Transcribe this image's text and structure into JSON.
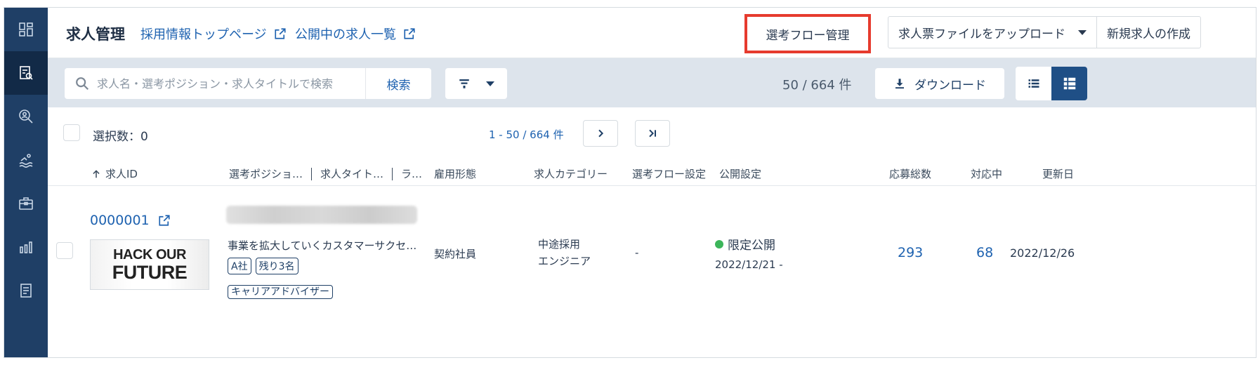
{
  "sidebar": {
    "items": [
      {
        "icon": "dashboard-icon"
      },
      {
        "icon": "job-list-icon"
      },
      {
        "icon": "candidate-search-icon"
      },
      {
        "icon": "swimmer-icon"
      },
      {
        "icon": "briefcase-icon"
      },
      {
        "icon": "analytics-icon"
      },
      {
        "icon": "document-icon"
      }
    ],
    "active_index": 1
  },
  "header": {
    "title": "求人管理",
    "link_recruit_top": "採用情報トップページ",
    "link_public_jobs": "公開中の求人一覧",
    "flow_button": "選考フロー管理",
    "upload_button": "求人票ファイルをアップロード",
    "new_job_button": "新規求人の作成"
  },
  "toolbar": {
    "search_placeholder": "求人名・選考ポジション・求人タイトルで検索",
    "search_button": "検索",
    "result_count": "50 / 664 件",
    "download_button": "ダウンロード"
  },
  "selection": {
    "selected_label": "選択数：0",
    "pager_text": "1 - 50 / 664 件"
  },
  "columns": {
    "job_id": "求人ID",
    "position": "選考ポジショ…",
    "job_title": "求人タイト…",
    "label": "ラ…",
    "employment_type": "雇用形態",
    "category": "求人カテゴリー",
    "flow_setting": "選考フロー設定",
    "publish_setting": "公開設定",
    "total_applicants": "応募総数",
    "in_progress": "対応中",
    "updated": "更新日"
  },
  "rows": [
    {
      "job_id": "0000001",
      "thumb_line1": "HACK OUR",
      "thumb_line2": "FUTURE",
      "position_text": "事業を拡大していくカスタマーサクセ…",
      "tag1": "A社",
      "tag2": "残り3名",
      "tag3": "キャリアアドバイザー",
      "employment_type": "契約社員",
      "category_line1": "中途採用",
      "category_line2": "エンジニア",
      "flow_setting": "-",
      "publish_status": "限定公開",
      "publish_date": "2022/12/21 -",
      "total_applicants": "293",
      "in_progress": "68",
      "updated": "2022/12/26"
    }
  ],
  "colors": {
    "sidebar": "#1f3f66",
    "sidebar_active": "#122a47",
    "link": "#1e62b0",
    "highlight_border": "#e63b2e",
    "toolbar_bg": "#dde4ec",
    "status_green": "#3cb55a"
  }
}
